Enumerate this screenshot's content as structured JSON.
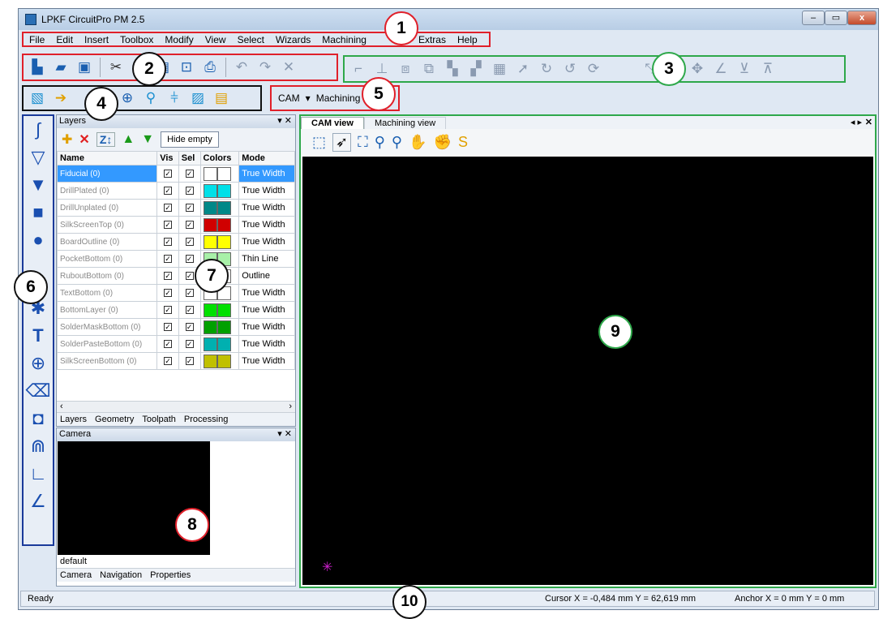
{
  "window": {
    "title": "LPKF CircuitPro PM 2.5",
    "min_label": "–",
    "max_label": "▭",
    "close_label": "x"
  },
  "menu": [
    "File",
    "Edit",
    "Insert",
    "Toolbox",
    "Modify",
    "View",
    "Select",
    "Wizards",
    "Machining",
    "Extras",
    "Help"
  ],
  "callouts": [
    "1",
    "2",
    "3",
    "4",
    "5",
    "6",
    "7",
    "8",
    "9",
    "10"
  ],
  "toolbar_cam": {
    "mode_label": "CAM",
    "mode_arrow": "▾",
    "machining_label": "Machining"
  },
  "layers_panel": {
    "title": "Layers",
    "hide_empty_label": "Hide empty",
    "columns": [
      "Name",
      "Vis",
      "Sel",
      "Colors",
      "Mode"
    ],
    "rows": [
      {
        "name": "Fiducial (0)",
        "color1": "#ffffff",
        "color2": "#ffffff",
        "mode": "True Width"
      },
      {
        "name": "DrillPlated (0)",
        "color1": "#00e0e8",
        "color2": "#00e0e8",
        "mode": "True Width"
      },
      {
        "name": "DrillUnplated (0)",
        "color1": "#008888",
        "color2": "#008888",
        "mode": "True Width"
      },
      {
        "name": "SilkScreenTop (0)",
        "color1": "#d00000",
        "color2": "#d00000",
        "mode": "True Width"
      },
      {
        "name": "BoardOutline (0)",
        "color1": "#ffff00",
        "color2": "#ffff00",
        "mode": "True Width"
      },
      {
        "name": "PocketBottom (0)",
        "color1": "#a8f0a8",
        "color2": "#a8f0a8",
        "mode": "Thin Line"
      },
      {
        "name": "RuboutBottom (0)",
        "color1": "#ffffff",
        "color2": "#ffffff",
        "mode": "Outline"
      },
      {
        "name": "TextBottom (0)",
        "color1": "#ffffff",
        "color2": "#ffffff",
        "mode": "True Width"
      },
      {
        "name": "BottomLayer (0)",
        "color1": "#00e000",
        "color2": "#00e000",
        "mode": "True Width"
      },
      {
        "name": "SolderMaskBottom (0)",
        "color1": "#00a000",
        "color2": "#00a000",
        "mode": "True Width"
      },
      {
        "name": "SolderPasteBottom (0)",
        "color1": "#00b0b0",
        "color2": "#00b0b0",
        "mode": "True Width"
      },
      {
        "name": "SilkScreenBottom (0)",
        "color1": "#c0c000",
        "color2": "#c0c000",
        "mode": "True Width"
      }
    ],
    "tabs": [
      "Layers",
      "Geometry",
      "Toolpath",
      "Processing"
    ]
  },
  "camera_panel": {
    "title": "Camera",
    "footer_text": "default",
    "tabs": [
      "Camera",
      "Navigation",
      "Properties"
    ]
  },
  "cam_view": {
    "tabs": [
      "CAM view",
      "Machining view"
    ],
    "nav_arrows": "◂ ▸"
  },
  "status": {
    "ready": "Ready",
    "cursor": "Cursor X =   -0,484 mm   Y =  62,619 mm",
    "anchor": "Anchor X =  0 mm   Y =  0 mm"
  },
  "colors": {
    "highlight_callout": "#e0202a",
    "green_callout": "#2ea84a",
    "canvas_bg": "#000000",
    "selected_row": "#3399ff"
  }
}
